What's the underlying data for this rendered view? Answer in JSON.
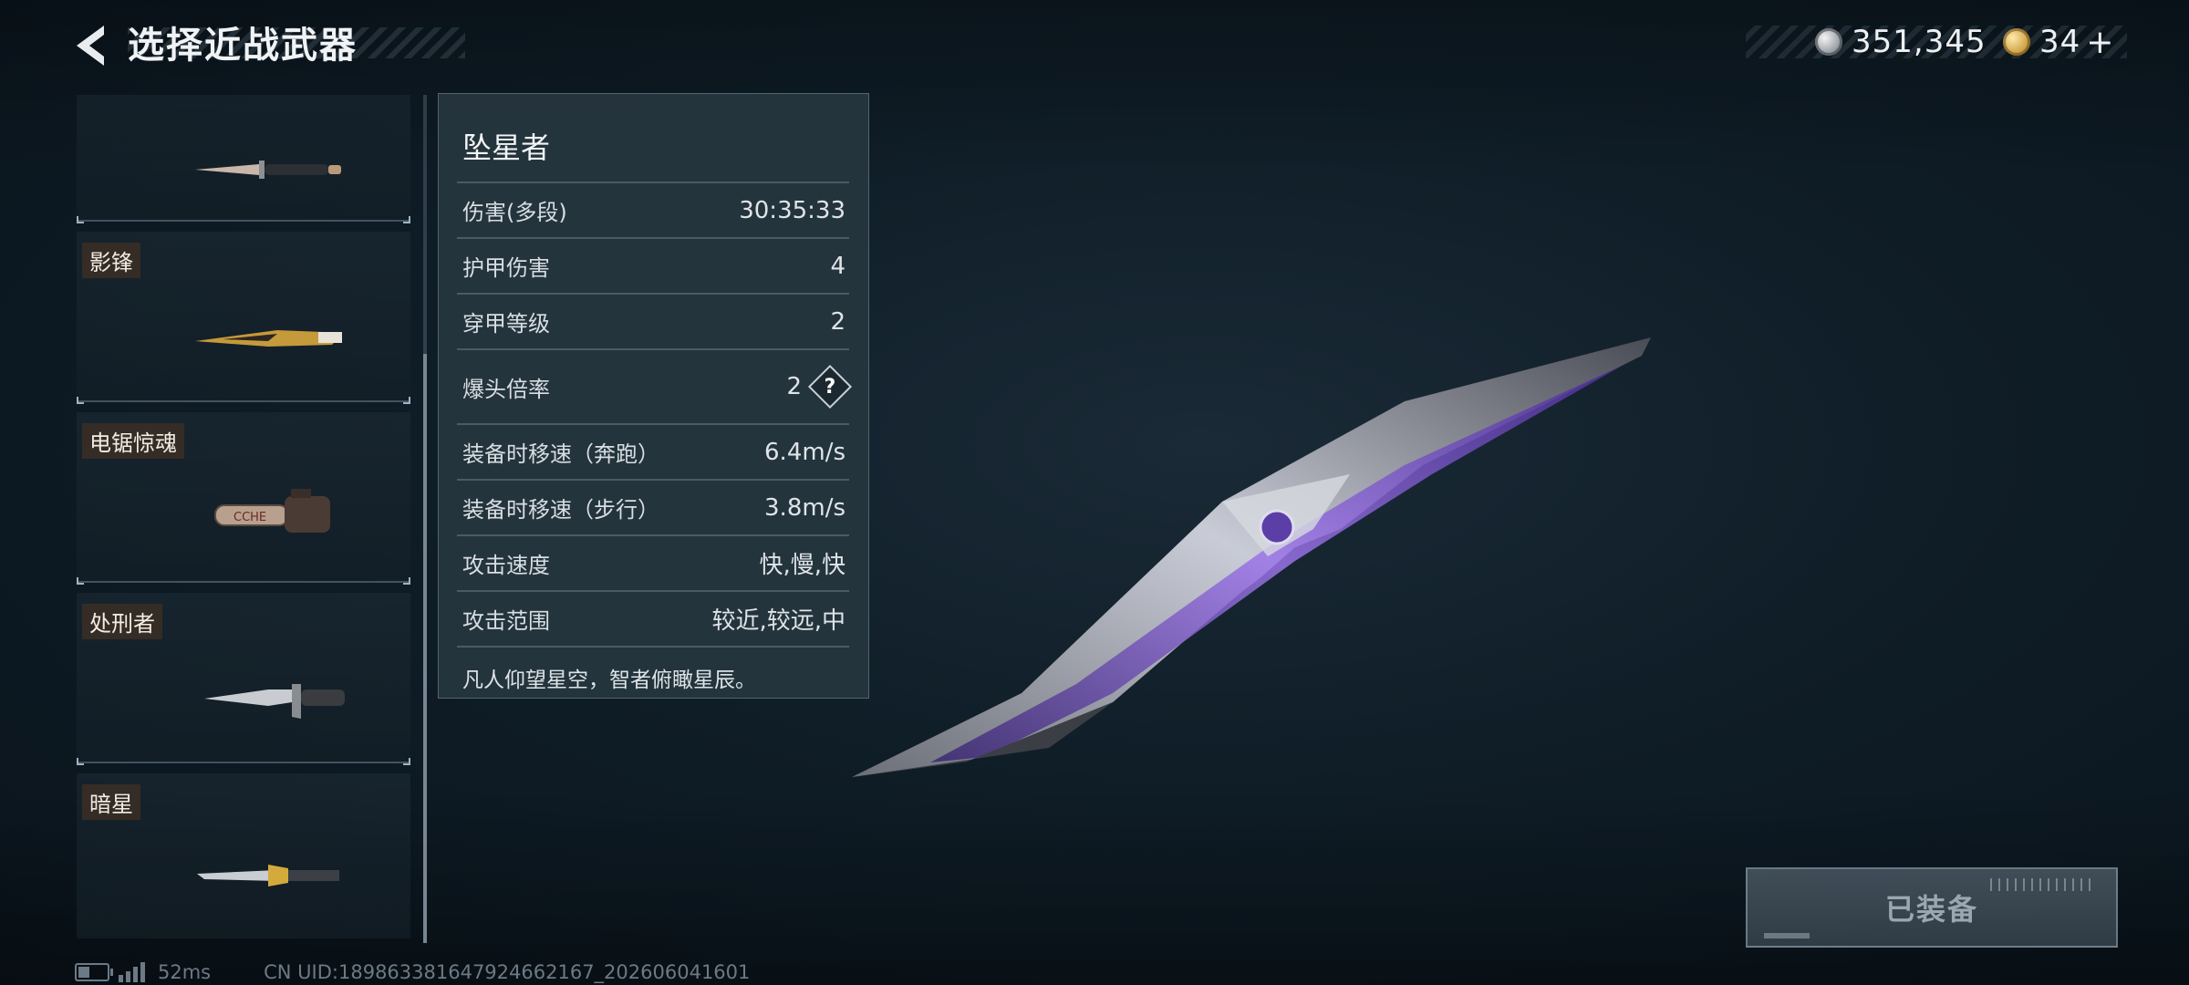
{
  "header": {
    "title": "选择近战武器"
  },
  "currency": {
    "silver_value": "351,345",
    "gold_value": "34",
    "plus_label": "+"
  },
  "weapons": [
    {
      "name": "",
      "image": "knife"
    },
    {
      "name": "影锋",
      "image": "golden-blade"
    },
    {
      "name": "电锯惊魂",
      "image": "chainsaw"
    },
    {
      "name": "处刑者",
      "image": "combat-knife"
    },
    {
      "name": "暗星",
      "image": "dark-star-blade"
    }
  ],
  "stats": {
    "weapon_title": "坠星者",
    "rows": [
      {
        "label": "伤害(多段)",
        "value": "30:35:33"
      },
      {
        "label": "护甲伤害",
        "value": "4"
      },
      {
        "label": "穿甲等级",
        "value": "2"
      },
      {
        "label": "爆头倍率",
        "value": "2",
        "help": "?"
      },
      {
        "label": "装备时移速（奔跑）",
        "value": "6.4m/s"
      },
      {
        "label": "装备时移速（步行）",
        "value": "3.8m/s"
      },
      {
        "label": "攻击速度",
        "value": "快,慢,快"
      },
      {
        "label": "攻击范围",
        "value": "较近,较远,中"
      }
    ],
    "description": "凡人仰望星空，智者俯瞰星辰。"
  },
  "equip_button": {
    "label": "已装备"
  },
  "status_bar": {
    "latency": "52ms",
    "uid": "CN UID:189863381647924662167_202606041601"
  },
  "colors": {
    "background": "#0f1d27",
    "panel": "#26363f",
    "accent_purple": "#7a4fd0",
    "tag_bg": "#3a2e24"
  }
}
